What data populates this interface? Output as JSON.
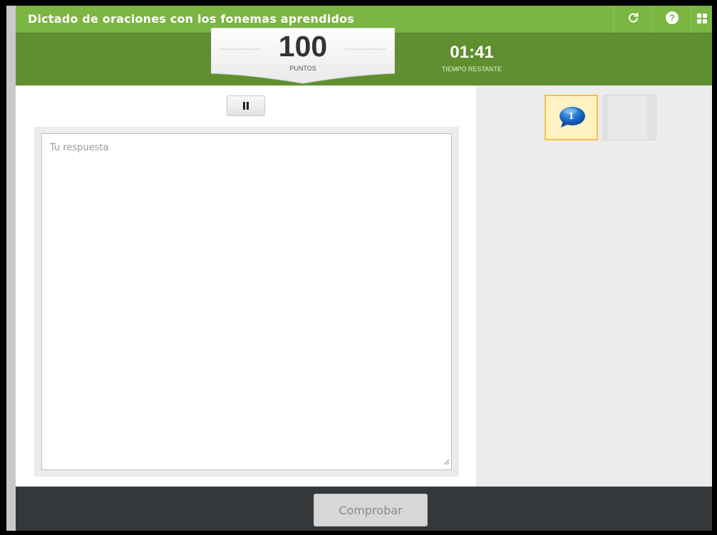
{
  "title": "Dictado de oraciones con los fonemas aprendidos",
  "toolbar": {
    "icons": [
      "refresh-icon",
      "help-icon",
      "grid-menu-icon"
    ]
  },
  "score": {
    "points": "100",
    "points_label": "PUNTOS",
    "time": "01:41",
    "time_label": "TIEMPO RESTANTE"
  },
  "answer": {
    "placeholder": "Tu respuesta",
    "value": ""
  },
  "questions": {
    "items": [
      {
        "number": "1",
        "state": "active"
      },
      {
        "number": "",
        "state": "empty"
      }
    ]
  },
  "footer": {
    "check_label": "Comprobar"
  },
  "colors": {
    "title_bar": "#7bb542",
    "score_bar": "#5f8f2f",
    "footer": "#35383b",
    "active_question_border": "#f2c24a"
  }
}
